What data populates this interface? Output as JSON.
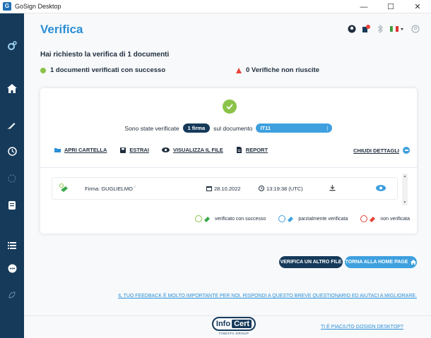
{
  "window": {
    "title": "GoSign Desktop",
    "logo_letter": "G",
    "controls": {
      "minimize": "—",
      "maximize": "☐",
      "close": "✕"
    }
  },
  "page": {
    "title": "Verifica"
  },
  "summary": {
    "request_text": "Hai richiesto la verifica di 1 documenti",
    "success_text": "1 documenti verificati con successo",
    "failed_text": "0 Verifiche non riuscite"
  },
  "card": {
    "verified_prefix": "Sono state verificate",
    "signatures_badge": "1 firma",
    "on_document": "sul documento",
    "document_name": "IT11",
    "actions": {
      "open_folder": "APRI CARTELLA",
      "extract": "ESTRAI",
      "view_file": "VISUALIZZA IL FILE",
      "report": "REPORT"
    },
    "close_details": "CHIUDI DETTAGLI",
    "signature": {
      "label": "Firma: GUGLIELMO `",
      "date": "28.10.2022",
      "time": "13:19:38 (UTC)"
    },
    "legend": {
      "success": "verificato con successo",
      "partial": "parzialmente verificata",
      "failed": "non verificata"
    }
  },
  "buttons": {
    "verify_another": "VERIFICA UN ALTRO FILE",
    "home": "TORNA ALLA HOME PAGE"
  },
  "footer": {
    "feedback": "IL TUO FEEDBACK È MOLTO IMPORTANTE PER NOI. RISPONDI A QUESTO BREVE QUESTIONARIO ED AIUTACI A MIGLIORARE.",
    "logo_info": "Info",
    "logo_cert": "Cert",
    "logo_sub": "TINEXTA GROUP",
    "liked": "TI È PIACIUTO GOSIGN DESKTOP?"
  },
  "colors": {
    "sidebar": "#163a5a",
    "accent": "#2a8ed6",
    "success": "#8bc34a",
    "error": "#e8443a"
  }
}
